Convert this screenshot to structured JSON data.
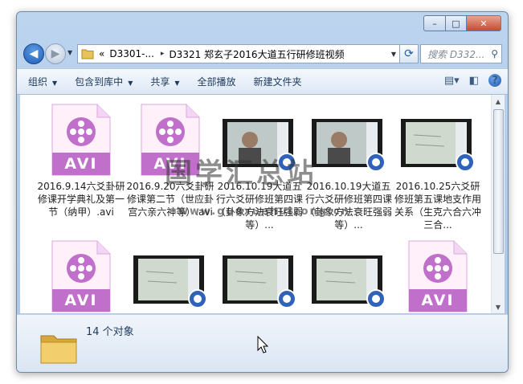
{
  "window": {
    "buttons": {
      "minimize": "–",
      "maximize": "□",
      "close": "✕"
    }
  },
  "nav": {
    "back_icon": "back-arrow-icon",
    "forward_icon": "forward-arrow-icon",
    "address": {
      "overflow": "«",
      "segment1": "D3301-...",
      "separator": "▸",
      "segment2": "D3321 郑玄子2016大道五行研修班视频"
    },
    "search_placeholder": "搜索 D332..."
  },
  "toolbar": {
    "organize": "组织",
    "include_in_library": "包含到库中",
    "share": "共享",
    "play_all": "全部播放",
    "new_folder": "新建文件夹"
  },
  "files": [
    {
      "type": "avi",
      "badge": "AVI",
      "name": "2016.9.14六爻卦研修课开学典礼及第一节（纳甲）.avi"
    },
    {
      "type": "avi",
      "badge": "AVI",
      "name": "2016.9.20六爻卦研修课第二节（世应卦宫六亲六神等）.avi"
    },
    {
      "type": "video",
      "name": "2016.10.19大道五行六爻研修班第四课（卦象方法衰旺强弱等）..."
    },
    {
      "type": "video",
      "name": "2016.10.19大道五行六爻研修班第四课（卦象方法衰旺强弱等）..."
    },
    {
      "type": "video",
      "name": "2016.10.25六爻研修班第五课地支作用关系（生克六合六冲三合..."
    },
    {
      "type": "avi",
      "badge": "AVI",
      "name": ""
    },
    {
      "type": "video",
      "name": ""
    },
    {
      "type": "video",
      "name": ""
    },
    {
      "type": "video",
      "name": ""
    },
    {
      "type": "avi",
      "badge": "AVI",
      "name": ""
    }
  ],
  "watermark": {
    "main": "国学汇总站",
    "url": "www.guoxuehuizong.cn"
  },
  "status": {
    "count": "14 个对象"
  },
  "colors": {
    "avi_purple": "#c06fca",
    "avi_bg": "#fff0fa",
    "accent": "#1e5cb3"
  }
}
